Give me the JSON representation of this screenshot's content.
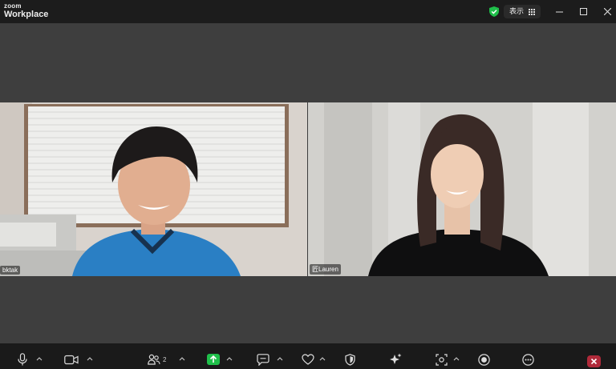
{
  "app": {
    "brand_small": "zoom",
    "brand_name": "Workplace"
  },
  "titlebar": {
    "view_label": "表示"
  },
  "participants": [
    {
      "name": "bktak"
    },
    {
      "name": "匠Lauren"
    }
  ],
  "toolbar": {
    "participants_count": "2"
  },
  "colors": {
    "accent_green": "#1fbf4a",
    "end_red": "#b02a3a",
    "titlebar_bg": "#1c1c1c",
    "toolbar_bg": "#1a1a1a"
  }
}
